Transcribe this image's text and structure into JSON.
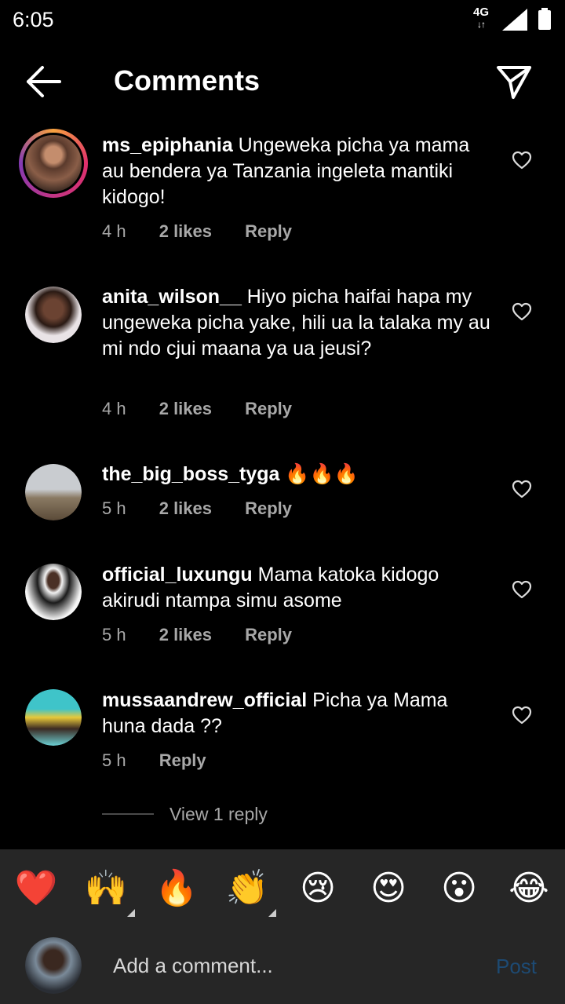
{
  "status_bar": {
    "time": "6:05",
    "network": "4G",
    "network_arrows": "↓↑"
  },
  "header": {
    "title": "Comments"
  },
  "comments": [
    {
      "username": "ms_epiphania",
      "text": " Ungeweka picha ya mama au bendera ya Tanzania ingeleta mantiki kidogo!",
      "time": "4 h",
      "likes": "2 likes",
      "reply": "Reply"
    },
    {
      "username": "anita_wilson__",
      "text": " Hiyo picha haifai hapa my ungeweka picha yake, hili ua la talaka my au mi ndo cjui maana ya ua jeusi?",
      "time": "4 h",
      "likes": "2 likes",
      "reply": "Reply"
    },
    {
      "username": "the_big_boss_tyga",
      "text": " 🔥🔥🔥",
      "time": "5 h",
      "likes": "2 likes",
      "reply": "Reply"
    },
    {
      "username": "official_luxungu",
      "text": " Mama katoka kidogo akirudi ntampa simu asome",
      "time": "5 h",
      "likes": "2 likes",
      "reply": "Reply"
    },
    {
      "username": "mussaandrew_official",
      "text": " Picha ya Mama huna dada ??",
      "time": "5 h",
      "reply": "Reply"
    }
  ],
  "view_replies": "View 1 reply",
  "emoji_bar": [
    "❤️",
    "🙌",
    "🔥",
    "👏",
    "😢",
    "😍",
    "😮",
    "😂"
  ],
  "composer": {
    "placeholder": "Add a comment...",
    "post_label": "Post"
  },
  "colors": {
    "background": "#000000",
    "bottom_bar": "#262626",
    "meta_text": "#a8a8a8",
    "post_disabled": "#1d4a73"
  }
}
